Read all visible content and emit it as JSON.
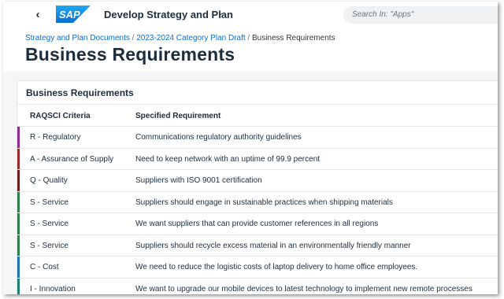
{
  "shell": {
    "back_icon": "chevron-left-icon",
    "logo_text": "SAP",
    "app_title": "Develop Strategy and Plan",
    "title_menu_icon": "chevron-down-icon",
    "search_placeholder": "Search In: \"Apps\""
  },
  "breadcrumb": {
    "items": [
      "Strategy and Plan Documents",
      "2023-2024 Category Plan Draft"
    ],
    "separator": "/",
    "current": "Business Requirements"
  },
  "page_title": "Business Requirements",
  "card": {
    "title": "Business Requirements",
    "columns": [
      "RAQSCI Criteria",
      "Specified Requirement"
    ],
    "rows": [
      {
        "criteria": "R - Regulatory",
        "requirement": "Communications regulatory authority guidelines",
        "color": "#8e2d91"
      },
      {
        "criteria": "A - Assurance of Supply",
        "requirement": "Need to keep network with an uptime of 99.9 percent",
        "color": "#9b2a2a"
      },
      {
        "criteria": "Q - Quality",
        "requirement": "Suppliers with ISO 9001 certification",
        "color": "#6b1f1f"
      },
      {
        "criteria": "S - Service",
        "requirement": "Suppliers should engage in sustainable practices when shipping materials",
        "color": "#2e7d4a"
      },
      {
        "criteria": "S - Service",
        "requirement": "We want suppliers that can provide customer references in all regions",
        "color": "#2e7d4a"
      },
      {
        "criteria": "S - Service",
        "requirement": "Suppliers should recycle excess material in an environmentally friendly manner",
        "color": "#2e7d4a"
      },
      {
        "criteria": "C - Cost",
        "requirement": "We need to reduce the logistic costs of laptop delivery to home office employees.",
        "color": "#1f73b7"
      },
      {
        "criteria": "I - Innovation",
        "requirement": "We want to upgrade our mobile devices to latest technology to implement new remote processes",
        "color": "#1e7f6e"
      }
    ]
  },
  "colors": {
    "brand": "#0a6ed1",
    "link": "#0a6ed1",
    "background": "#f5f6f7"
  }
}
